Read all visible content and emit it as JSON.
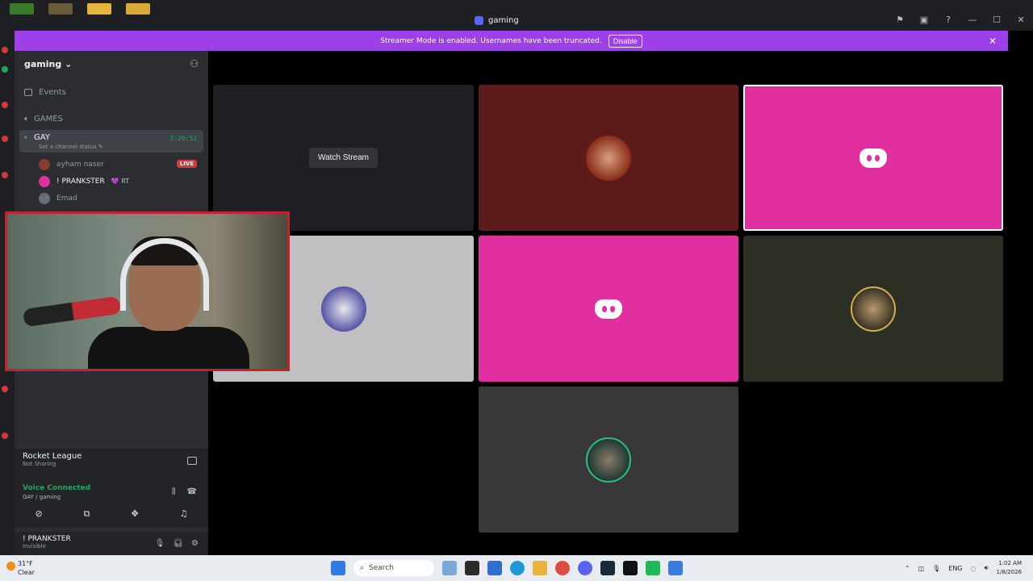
{
  "window": {
    "title": "gaming"
  },
  "banner": {
    "text": "Streamer Mode is enabled. Usernames have been truncated.",
    "button": "Disable"
  },
  "server": {
    "name": "gaming"
  },
  "sidebar": {
    "events_label": "Events",
    "category": "GAMES",
    "voice_channel": {
      "name": "GAY",
      "status_placeholder": "Set a channel status",
      "duration": "2:20:52"
    },
    "members": [
      {
        "name": "ayham naser",
        "live": "LIVE"
      },
      {
        "name": "! PRANKSTER",
        "badge": "💜 RT"
      },
      {
        "name": "Emad"
      }
    ]
  },
  "activity": {
    "game": "Rocket League",
    "status": "Not Sharing"
  },
  "voice": {
    "title": "Voice Connected",
    "channel": "GAY / gaming"
  },
  "user": {
    "name": "! PRANKSTER",
    "status": "Invisible"
  },
  "stage": {
    "watch_label": "Watch Stream"
  },
  "taskbar": {
    "weather_temp": "31°F",
    "weather_desc": "Clear",
    "search_placeholder": "Search",
    "lang": "ENG",
    "time": "1:02 AM",
    "date": "1/8/2026"
  },
  "colors": {
    "accent": "#9d3fea",
    "discord_pink": "#e12f9f",
    "live_red": "#da373c",
    "connected_green": "#23a55a"
  }
}
